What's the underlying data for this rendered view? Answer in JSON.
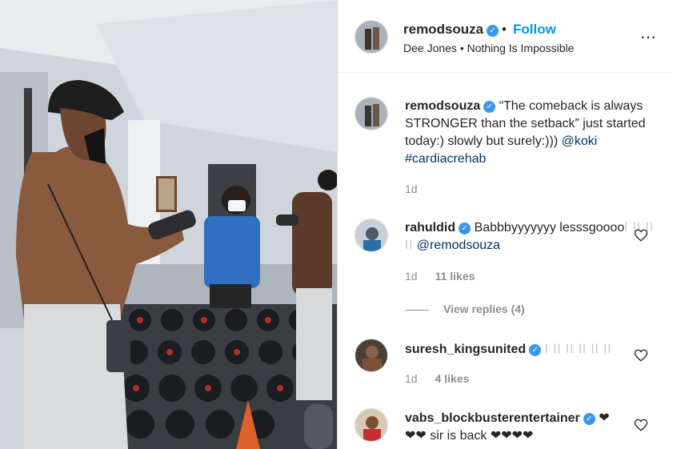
{
  "post": {
    "owner": "remodsouza",
    "dot": "•",
    "follow_label": "Follow",
    "audio": "Dee Jones • Nothing Is Impossible",
    "more_icon": "⋯",
    "caption": {
      "username": "remodsouza",
      "text": "“The comeback is always STRONGER than the setback” just started today:) slowly but surely:)))",
      "mention": "@koki",
      "hashtag": "#cardiacrehab",
      "time": "1d"
    }
  },
  "comments": [
    {
      "username": "rahuldid",
      "verified": true,
      "text": "Babbbyyyyyyy lesssgoooo",
      "faint": "ǀ ǀǀ ǀǀ ǀǀ",
      "mention": "@remodsouza",
      "time": "1d",
      "likes": "11 likes",
      "view_replies": "View replies (4)"
    },
    {
      "username": "suresh_kingsunited",
      "verified": true,
      "faint": "ǀ ǀǀ ǀǀ ǀǀ ǀǀ ǀǀ",
      "time": "1d",
      "likes": "4 likes"
    },
    {
      "username": "vabs_blockbusterentertainer",
      "verified": true,
      "text_line1": "❤",
      "text_line2": "❤❤ sir is back ❤❤❤❤"
    }
  ],
  "colors": {
    "accent": "#0095f6",
    "verified": "#3897f0",
    "muted": "#8e8e8e",
    "text": "#262626"
  }
}
